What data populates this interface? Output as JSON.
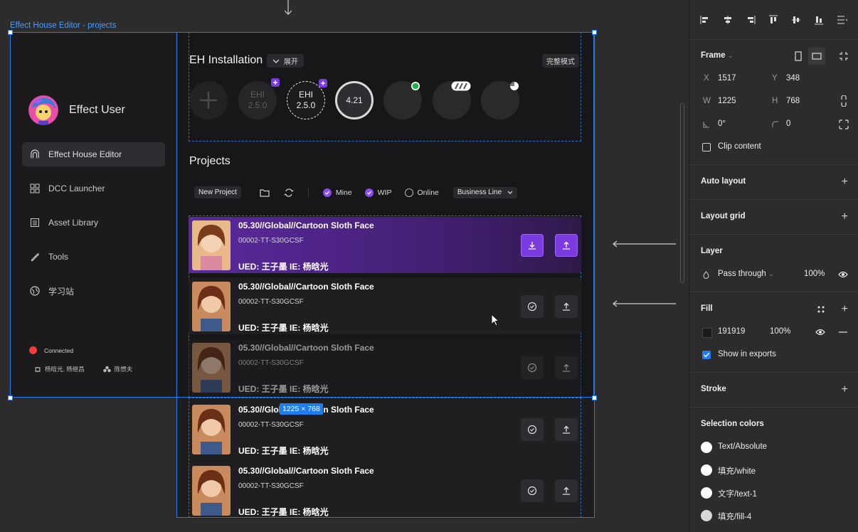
{
  "canvas": {
    "frame_label": "Effect House Editor - projects",
    "size_badge": "1225 × 768"
  },
  "sidebar": {
    "user_name": "Effect User",
    "items": [
      {
        "label": "Effect House Editor",
        "icon": "arch-icon",
        "active": true
      },
      {
        "label": "DCC Launcher",
        "icon": "grid-icon",
        "active": false
      },
      {
        "label": "Asset Library",
        "icon": "library-icon",
        "active": false
      },
      {
        "label": "Tools",
        "icon": "wrench-icon",
        "active": false
      },
      {
        "label": "学习站",
        "icon": "globe-icon",
        "active": false
      }
    ],
    "status": "Connected",
    "status_color": "#f23b3b",
    "member_left": "杨晗光, 杨继昌",
    "member_right": "陈惯夫"
  },
  "installation": {
    "title": "EH Installation",
    "expand_label": "展开",
    "full_mode_label": "完整模式",
    "versions": [
      {
        "l1": "EHI",
        "l2": "2.5.0"
      },
      {
        "l1": "EHI",
        "l2": "2.5.0"
      },
      {
        "l1": "4.21"
      }
    ]
  },
  "projects": {
    "title": "Projects",
    "new_project_label": "New Project",
    "filters": [
      {
        "label": "Mine",
        "checked": true
      },
      {
        "label": "WIP",
        "checked": true
      },
      {
        "label": "Online",
        "checked": false
      }
    ],
    "business_line": "Business Line",
    "rows": [
      {
        "title": "05.30//Global//Cartoon Sloth Face",
        "code": "00002-TT-S30GCSF",
        "people": "UED: 王子墨  IE: 杨晗光"
      },
      {
        "title": "05.30//Global//Cartoon Sloth Face",
        "code": "00002-TT-S30GCSF",
        "people": "UED: 王子墨  IE: 杨晗光"
      },
      {
        "title": "05.30//Global//Cartoon Sloth Face",
        "code": "00002-TT-S30GCSF",
        "people": "UED: 王子墨  IE: 杨晗光"
      },
      {
        "title": "05.30//Global//Cartoon Sloth Face",
        "code": "00002-TT-S30GCSF",
        "people": "UED: 王子墨  IE: 杨晗光"
      },
      {
        "title": "05.30//Global//Cartoon Sloth Face",
        "code": "00002-TT-S30GCSF",
        "people": "UED: 王子墨  IE: 杨晗光"
      }
    ]
  },
  "panel": {
    "frame": {
      "title": "Frame",
      "x_label": "X",
      "x": "1517",
      "y_label": "Y",
      "y": "348",
      "w_label": "W",
      "w": "1225",
      "h_label": "H",
      "h": "768",
      "rotation": "0°",
      "radius": "0",
      "clip_content": "Clip content"
    },
    "auto_layout": "Auto layout",
    "layout_grid": "Layout grid",
    "layer": {
      "title": "Layer",
      "blend": "Pass through",
      "opacity": "100%"
    },
    "fill": {
      "title": "Fill",
      "hex": "191919",
      "opacity": "100%",
      "swatch": "#191919",
      "show_in_exports": "Show in exports"
    },
    "stroke": "Stroke",
    "selection_colors": {
      "title": "Selection colors",
      "items": [
        {
          "label": "Text/Absolute",
          "color": "#ffffff"
        },
        {
          "label": "填充/white",
          "color": "#ffffff"
        },
        {
          "label": "文字/text-1",
          "color": "#ffffff"
        },
        {
          "label": "填充/fill-4",
          "color": "#d9d9d9"
        }
      ]
    }
  },
  "colors": {
    "accent": "#7b3be0",
    "selection": "#1e7ef0",
    "connected_dot": "#f23b3b"
  }
}
